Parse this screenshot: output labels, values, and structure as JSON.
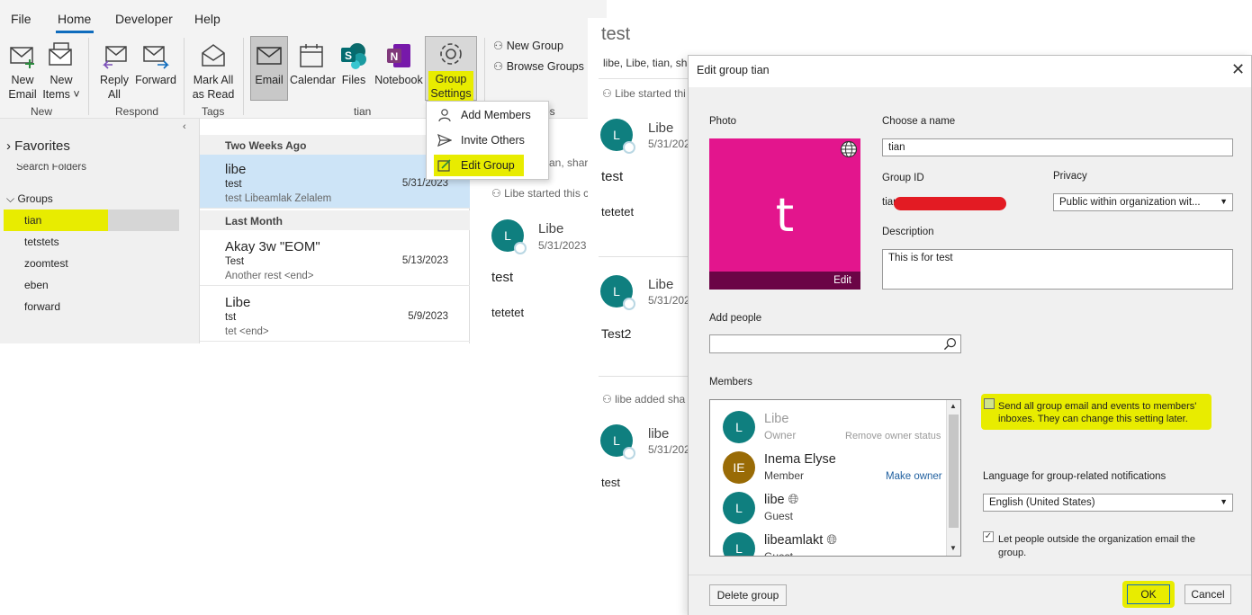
{
  "menu": {
    "file": "File",
    "home": "Home",
    "developer": "Developer",
    "help": "Help"
  },
  "ribbon": {
    "new_email": [
      "New",
      "Email"
    ],
    "new_items": [
      "New",
      "Items ˅"
    ],
    "reply_all": [
      "Reply",
      "All"
    ],
    "forward": "Forward",
    "mark_all_read": [
      "Mark All",
      "as Read"
    ],
    "email": "Email",
    "calendar": "Calendar",
    "files": "Files",
    "notebook": "Notebook",
    "group_settings": [
      "Group",
      "Settings ˅"
    ],
    "new_group": "New Group",
    "browse_groups": "Browse Groups",
    "groups": {
      "new": "New",
      "respond": "Respond",
      "tags": "Tags",
      "tian": "tian",
      "ps": "ps"
    }
  },
  "dropdown": {
    "add_members": "Add Members",
    "invite_others": "Invite Others",
    "edit_group": "Edit Group"
  },
  "folders": {
    "favorites": "Favorites",
    "search_folders": "Search Folders",
    "groups": "Groups",
    "items": [
      "tian",
      "tetstets",
      "zoomtest",
      "eben",
      "forward"
    ]
  },
  "message_list": {
    "two_weeks_ago": "Two Weeks Ago",
    "last_month": "Last Month",
    "items": [
      {
        "from": "libe",
        "subject": "test",
        "preview": "test  Libeamlak Zelalem",
        "date": "5/31/2023"
      },
      {
        "from": "Akay 3w \"EOM\"",
        "subject": "Test",
        "preview": "Another rest <end>",
        "date": "5/13/2023"
      },
      {
        "from": "Libe",
        "subject": "tst",
        "preview": "tet <end>",
        "date": "5/9/2023"
      }
    ]
  },
  "reading": {
    "names_short": "an, share",
    "started": "Libe started this c",
    "name": "Libe",
    "date": "5/31/2023",
    "subject": "test",
    "body": "tetetet"
  },
  "conversation": {
    "title": "test",
    "members_line": "libe, Libe, tian, sha",
    "started": "Libe started thi",
    "posts": [
      {
        "name": "Libe",
        "date": "5/31/202",
        "subject": "test",
        "body": "tetetet"
      },
      {
        "name": "Libe",
        "date": "5/31/202",
        "body": "Test2"
      },
      {
        "name": "libe",
        "date": "5/31/202",
        "body": "test"
      }
    ],
    "added": "libe added sha"
  },
  "dialog": {
    "title": "Edit group tian",
    "photo_label": "Photo",
    "photo_letter": "t",
    "photo_edit": "Edit",
    "name_label": "Choose a name",
    "name_value": "tian",
    "group_id_label": "Group ID",
    "group_id_value": "tian",
    "privacy_label": "Privacy",
    "privacy_value": "Public within organization wit...",
    "description_label": "Description",
    "description_value": "This is for test",
    "add_people_label": "Add people",
    "add_people_value": "",
    "members_label": "Members",
    "members": [
      {
        "initials": "L",
        "name": "Libe",
        "role": "Owner",
        "action": "Remove owner status"
      },
      {
        "initials": "IE",
        "name": "Inema Elyse",
        "role": "Member",
        "action": "Make owner"
      },
      {
        "initials": "L",
        "name": "libe",
        "role": "Guest",
        "action": ""
      },
      {
        "initials": "L",
        "name": "libeamlakt",
        "role": "Guest",
        "action": ""
      }
    ],
    "send_all_line1": "Send all group email and events to members'",
    "send_all_line2": "inboxes. They can change this setting later.",
    "language_label": "Language for group-related notifications",
    "language_value": "English (United States)",
    "outside_line1": "Let people outside the organization email the",
    "outside_line2": "group.",
    "delete_group": "Delete group",
    "ok": "OK",
    "cancel": "Cancel"
  },
  "colors": {
    "accent": "#0f6cbd",
    "highlight": "#e8ec00",
    "photo": "#e3158d",
    "avatar": "#0f7f7f",
    "avatar_ie": "#996b06"
  }
}
